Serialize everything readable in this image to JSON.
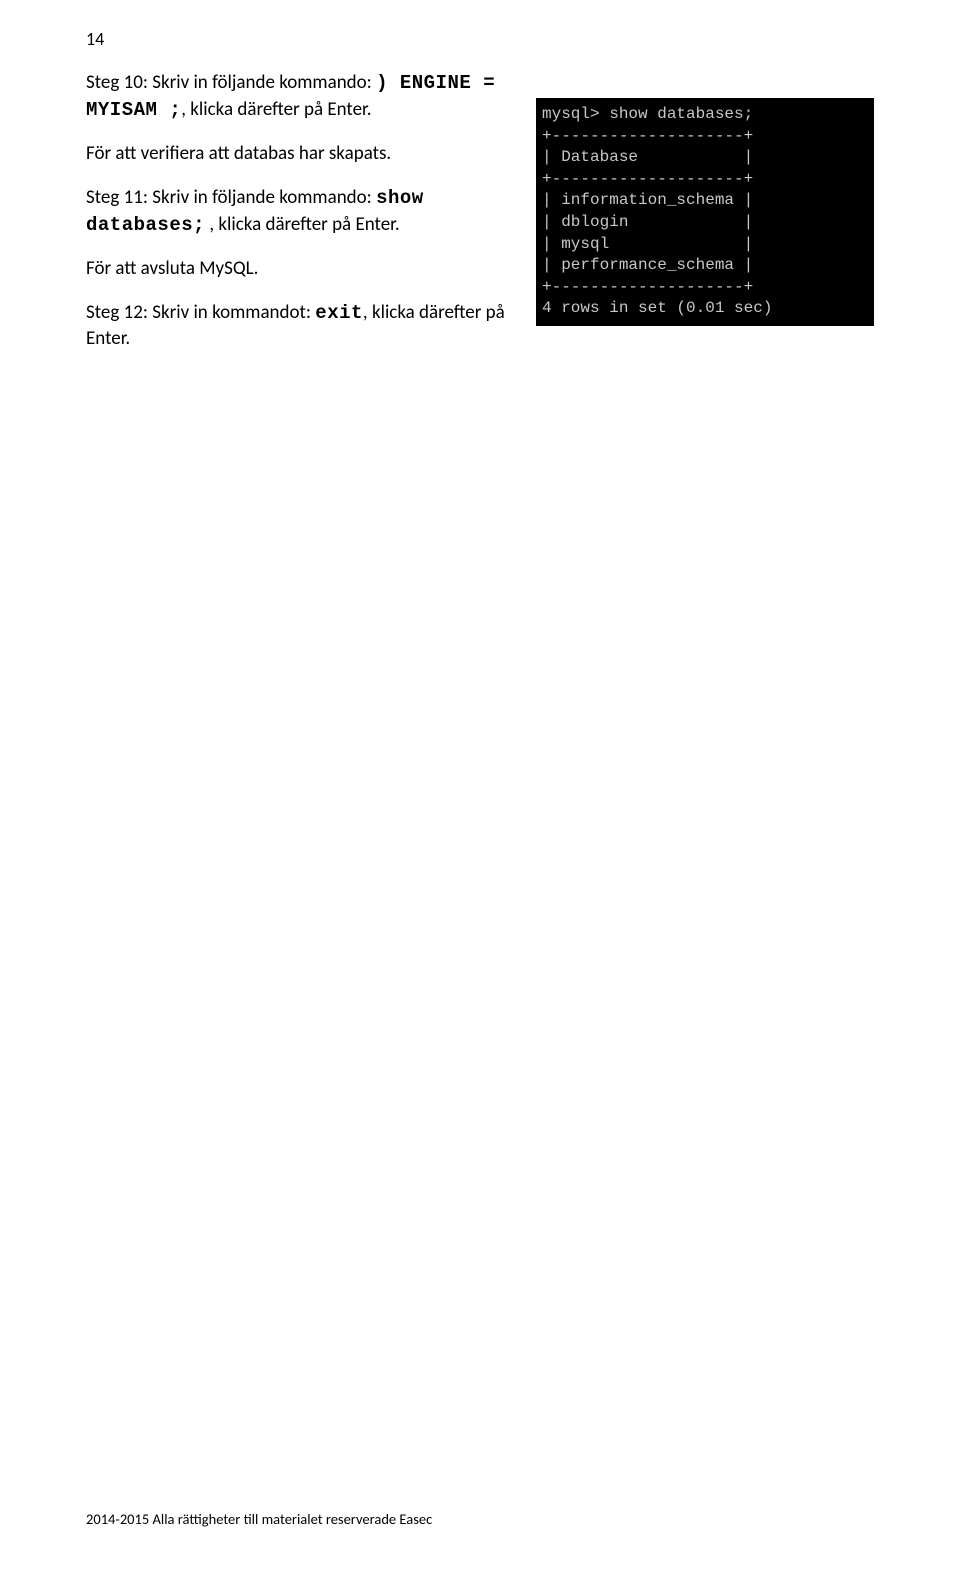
{
  "page_number": "14",
  "paragraphs": {
    "p1_pre": "Steg 10: Skriv in följande kommando: ",
    "p1_code": ") ENGINE = MYISAM ;",
    "p1_post": ", klicka därefter på Enter.",
    "p2": "För att verifiera att databas har skapats.",
    "p3_pre": "Steg 11: Skriv in följande kommando: ",
    "p3_code1": "show",
    "p3_code2": "databases;",
    "p3_mid": " , klicka därefter på Enter.",
    "p4": "För att avsluta MySQL.",
    "p5_pre": "Steg 12: Skriv in kommandot: ",
    "p5_code": "exit",
    "p5_post": ", klicka därefter på Enter."
  },
  "terminal": {
    "lines": "mysql> show databases;\n+--------------------+\n| Database           |\n+--------------------+\n| information_schema |\n| dblogin            |\n| mysql              |\n| performance_schema |\n+--------------------+\n4 rows in set (0.01 sec)"
  },
  "footer": "2014-2015 Alla rättigheter till materialet reserverade Easec"
}
